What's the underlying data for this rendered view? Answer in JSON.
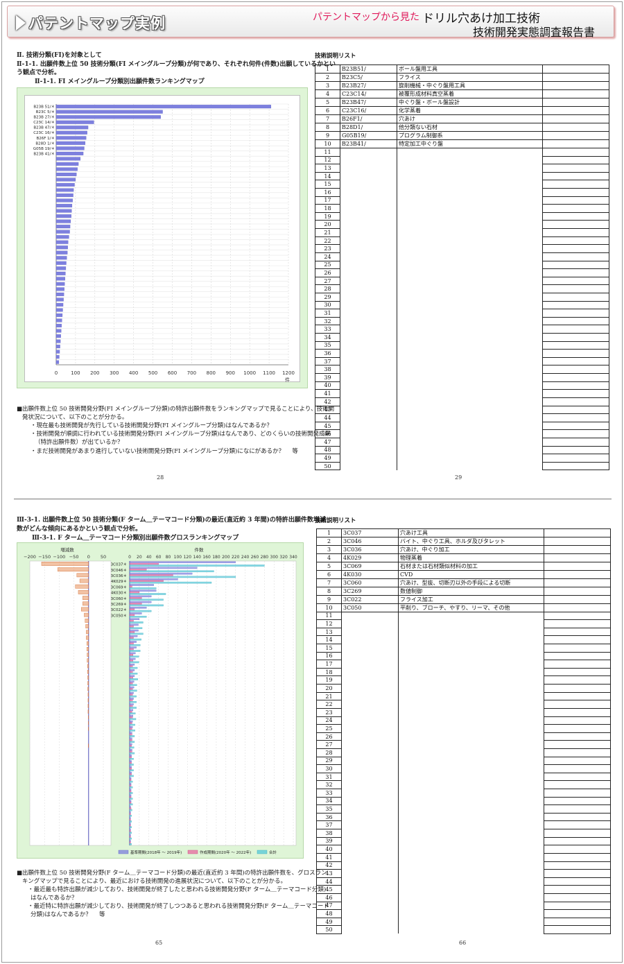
{
  "banner": {
    "title": "パテントマップ実例",
    "from": "パテントマップから見た",
    "subtitle1": "ドリル穴あけ加工技術",
    "subtitle2": "技術開発実態調査報告書"
  },
  "top": {
    "heading1": "Ⅱ. 技術分類(FI)を対象として",
    "heading2a": "Ⅱ-1-1. 出願件数上位 50 技術分類(FI メイングループ分類)が何であり、それぞれ何件(件数)出願しているかとい",
    "heading2b": "う観点で分析。",
    "chart_caption": "Ⅱ-1-1. FI メイングループ分類別出願件数ランキングマップ",
    "para1": "■出願件数上位 50 技術開発分野(FI メイングループ分類)の特許出願件数をランキングマップで見ることにより、技術開",
    "para2": "発状況について、以下のことが分かる。",
    "para3": "・現在最も技術開発が先行している技術開発分野(FI メイングループ分類)はなんであるか？",
    "para4": "・技術開発が順調に行われている技術開発分野(FI メイングループ分類)はなんであり、どのくらいの技術開発成果",
    "para5": "（特許出願件数）が出ているか？",
    "para6": "・まだ技術開発があまり進行していない技術開発分野(FI メイングループ分類)になにがあるか？　 等",
    "page_left": "28",
    "page_right": "29",
    "table_title": "技術説明リスト",
    "table_rows": [
      {
        "no": "1",
        "code": "B23B51/",
        "desc": "ボール盤用工具"
      },
      {
        "no": "2",
        "code": "B23C5/",
        "desc": "フライス"
      },
      {
        "no": "3",
        "code": "B23B27/",
        "desc": "旋削機械・中ぐり盤用工具"
      },
      {
        "no": "4",
        "code": "C23C14/",
        "desc": "被覆形成材料真空蒸着"
      },
      {
        "no": "5",
        "code": "B23B47/",
        "desc": "中ぐり盤・ボール盤設計"
      },
      {
        "no": "6",
        "code": "C23C16/",
        "desc": "化学蒸着"
      },
      {
        "no": "7",
        "code": "B26F1/",
        "desc": "穴あけ"
      },
      {
        "no": "8",
        "code": "B28D1/",
        "desc": "他分類ない石材"
      },
      {
        "no": "9",
        "code": "G05B19/",
        "desc": "プログラム制御系"
      },
      {
        "no": "10",
        "code": "B23B41/",
        "desc": "特定加工中ぐり盤"
      }
    ]
  },
  "bottom": {
    "heading1a": "Ⅲ-3-1. 出願件数上位 50 技術分類(F ターム＿テーマコード分類)の最近(直近約 3 年間)の特許出願件数増減",
    "heading1b": "数がどんな傾向にあるかという観点で分析。",
    "chart_caption": "Ⅲ-3-1. F ターム＿テーマコード分類別出願件数グロスランキングマップ",
    "para1": "■出願件数上位 50 技術開発分野(F ターム＿テーマコード分類)の最近(直近約 3 年間)の特許出願件数を、グロスラン",
    "para2": "キングマップで見ることにより、最近における技術開発の進展状況について、以下のことが分かる。",
    "para3": "・最近最も特許出願が減少しており、技術開発が終了したと思われる技術開発分野(F ターム＿テーマコード分類)",
    "para4": "はなんであるか？",
    "para5": "・最近特に特許出願が減少しており、技術開発が終了しつつあると思われる技術開発分野(F ターム＿テーマコード",
    "para6": "分類)はなんであるか？　 等",
    "page_left": "65",
    "page_right": "66",
    "table_title": "技術説明リスト",
    "table_rows": [
      {
        "no": "1",
        "code": "3C037",
        "desc": "穴あけ工具"
      },
      {
        "no": "2",
        "code": "3C046",
        "desc": "バイト、中ぐり工具、ホルダ及びタレット"
      },
      {
        "no": "3",
        "code": "3C036",
        "desc": "穴あけ、中ぐり加工"
      },
      {
        "no": "4",
        "code": "4K029",
        "desc": "物理蒸着"
      },
      {
        "no": "5",
        "code": "3C069",
        "desc": "石材または石材類似材料の加工"
      },
      {
        "no": "6",
        "code": "4K030",
        "desc": "CVD"
      },
      {
        "no": "7",
        "code": "3C060",
        "desc": "穴あけ、型抜、切断刃以外の手段による切断"
      },
      {
        "no": "8",
        "code": "3C269",
        "desc": "数値制御"
      },
      {
        "no": "9",
        "code": "3C022",
        "desc": "フライス加工"
      },
      {
        "no": "10",
        "code": "3C050",
        "desc": "平削り、ブローチ、やすり、リーマ、その他"
      }
    ]
  },
  "chart_data": [
    {
      "type": "bar",
      "orientation": "horizontal",
      "categories": [
        "B23B 51/＊",
        "B23C 5/＊",
        "B23B 27/＊",
        "C23C 14/＊",
        "B23B 47/＊",
        "C23C 16/＊",
        "B26F 1/＊",
        "B28D 1/＊",
        "G05B 19/＊",
        "B23B 41/＊"
      ],
      "values": [
        1110,
        550,
        540,
        195,
        165,
        160,
        155,
        150,
        145,
        140,
        125,
        115,
        110,
        105,
        100,
        95,
        90,
        88,
        85,
        82,
        80,
        78,
        75,
        72,
        70,
        66,
        62,
        60,
        58,
        55,
        52,
        50,
        48,
        46,
        44,
        42,
        40,
        38,
        36,
        34,
        32,
        30,
        28,
        26,
        24,
        22,
        20,
        18,
        16,
        14
      ],
      "xlabel": "件",
      "xlim": [
        0,
        1200
      ],
      "xticks": [
        "0",
        "100",
        "200",
        "300",
        "400",
        "500",
        "600",
        "700",
        "800",
        "900",
        "1000",
        "1100",
        "1200"
      ],
      "colors": {
        "bar": "#7d80de"
      }
    },
    {
      "type": "bar",
      "orientation": "horizontal",
      "categories": [
        "3C037＊",
        "3C046＊",
        "3C036＊",
        "4K029＊",
        "3C069＊",
        "4K030＊",
        "3C060＊",
        "3C269＊",
        "3C022＊",
        "3C050＊"
      ],
      "left_panel": {
        "xlabel": "増減数",
        "xlim": [
          -200,
          50
        ],
        "xticks": [
          "−200",
          "−150",
          "−100",
          "−50",
          "0",
          "50"
        ],
        "values": [
          -160,
          -105,
          -40,
          -30,
          -45,
          -35,
          -20,
          -20,
          -25,
          -15,
          -12,
          -10,
          -8,
          -8,
          -6,
          -6,
          -5,
          -5,
          -4,
          -4,
          -3,
          -3,
          -3,
          -2,
          -2,
          -2,
          -2,
          -1,
          -1,
          -1,
          0,
          0,
          -1,
          0,
          0,
          0,
          0,
          0,
          0,
          0,
          0,
          0,
          0,
          0,
          0,
          0,
          0,
          0,
          0,
          0
        ]
      },
      "right_panel": {
        "xlabel": "件数",
        "xlim": [
          0,
          340
        ],
        "xticks": [
          "0",
          "20",
          "40",
          "60",
          "80",
          "100",
          "120",
          "140",
          "160",
          "180",
          "200",
          "220",
          "240",
          "260",
          "280",
          "300",
          "320",
          "340"
        ],
        "series": [
          {
            "name": "基準期間(2018年 ～ 2019年)",
            "values": [
              220,
              140,
              130,
              100,
              50,
              55,
              45,
              45,
              35,
              25,
              20,
              18,
              18,
              16,
              14,
              14,
              12,
              12,
              10,
              10,
              10,
              9,
              9,
              8,
              8,
              8,
              7,
              7,
              6,
              6,
              5,
              5,
              5,
              5,
              4,
              4,
              4,
              4,
              3,
              3,
              3,
              3,
              3,
              2,
              2,
              2,
              2,
              2,
              2,
              2
            ]
          },
          {
            "name": "作成期間(2020年 ～ 2022年)",
            "values": [
              60,
              35,
              90,
              70,
              5,
              20,
              25,
              25,
              10,
              10,
              8,
              8,
              10,
              8,
              8,
              8,
              7,
              7,
              6,
              6,
              7,
              6,
              6,
              6,
              6,
              6,
              5,
              6,
              5,
              5,
              5,
              5,
              4,
              5,
              4,
              4,
              4,
              4,
              3,
              3,
              3,
              3,
              3,
              3,
              2,
              2,
              2,
              2,
              2,
              2
            ]
          },
          {
            "name": "合計",
            "values": [
              280,
              175,
              220,
              170,
              55,
              75,
              70,
              70,
              45,
              35,
              28,
              26,
              28,
              24,
              22,
              22,
              19,
              19,
              16,
              16,
              17,
              15,
              15,
              14,
              14,
              14,
              12,
              13,
              11,
              11,
              10,
              10,
              9,
              10,
              8,
              8,
              8,
              8,
              6,
              6,
              6,
              6,
              6,
              5,
              4,
              4,
              4,
              4,
              4,
              4
            ]
          }
        ]
      },
      "colors": {
        "delta": "#e8905a",
        "base": "#7d80de",
        "recent": "#e86aa0",
        "total": "#54c8d8"
      }
    }
  ]
}
